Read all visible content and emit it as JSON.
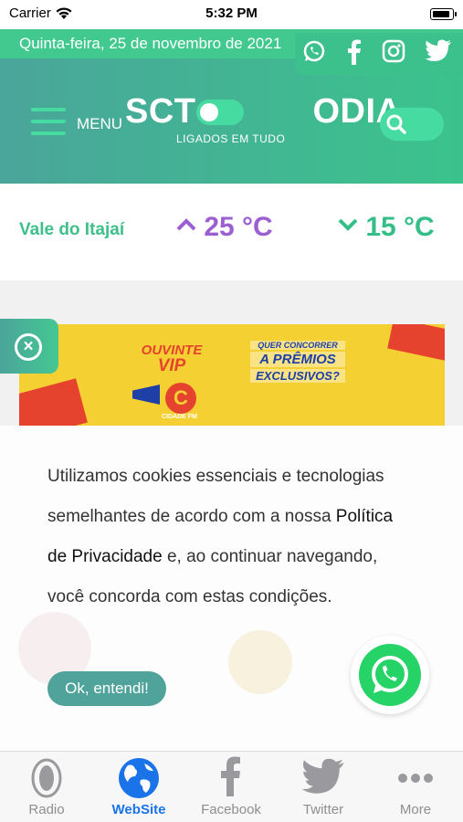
{
  "status_bar": {
    "carrier": "Carrier",
    "time": "5:32 PM"
  },
  "header": {
    "date": "Quinta-feira, 25 de novembro de 2021",
    "social": [
      "whatsapp-icon",
      "facebook-icon",
      "instagram-icon",
      "twitter-icon"
    ],
    "menu_label": "MENU",
    "logo_left": "SCT",
    "logo_right": "ODIA",
    "tagline": "LIGADOS EM TUDO"
  },
  "weather": {
    "region": "Vale do Itajaí",
    "high": "25 °C",
    "low": "15 °C"
  },
  "banner": {
    "left_line1": "OUVINTE",
    "left_line2": "VIP",
    "brand": "CIDADE FM",
    "right_line1": "QUER CONCORRER",
    "right_line2": "A PRÊMIOS",
    "right_line3": "EXCLUSIVOS?"
  },
  "cookie": {
    "text_before": "Utilizamos cookies essenciais e tecnologias semelhantes de acordo com a nossa ",
    "policy_link": "Política de Privacidade",
    "text_after": " e, ao continuar navegando, você concorda com estas condições.",
    "ok_label": "Ok, entendi!"
  },
  "tabbar": {
    "items": [
      {
        "label": "Radio",
        "icon": "radio-icon"
      },
      {
        "label": "WebSite",
        "icon": "globe-icon",
        "active": true
      },
      {
        "label": "Facebook",
        "icon": "facebook-icon"
      },
      {
        "label": "Twitter",
        "icon": "twitter-icon"
      },
      {
        "label": "More",
        "icon": "more-icon"
      }
    ]
  },
  "colors": {
    "brand_green": "#3bc38c",
    "teal": "#4aa59a",
    "purple": "#9b5fd1",
    "tab_active": "#1a73e8"
  }
}
